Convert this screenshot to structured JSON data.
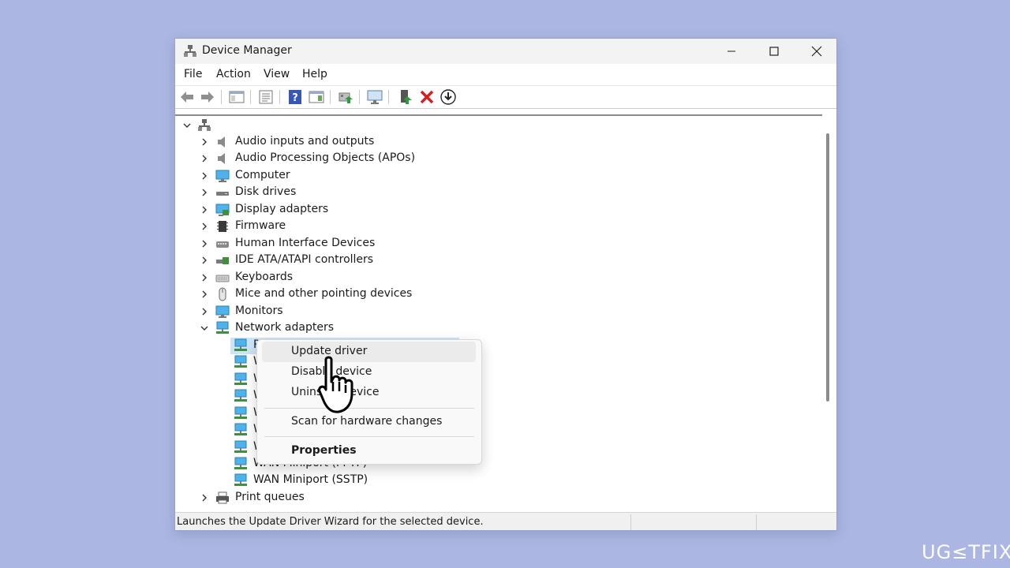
{
  "window": {
    "title": "Device Manager",
    "controls": [
      "minimize-icon",
      "maximize-icon",
      "close-icon"
    ]
  },
  "menu": [
    "File",
    "Action",
    "View",
    "Help"
  ],
  "toolbar": {
    "buttons": [
      "back-arrow-icon",
      "forward-arrow-icon",
      "show-hide-console-tree-icon",
      "properties-icon",
      "help-icon",
      "action-pane-icon",
      "update-driver-icon",
      "scan-hardware-icon",
      "enable-device-icon",
      "uninstall-device-icon",
      "download-icon"
    ]
  },
  "tree": {
    "root_label": "",
    "categories": [
      {
        "label": "Audio inputs and outputs",
        "icon": "speaker-icon"
      },
      {
        "label": "Audio Processing Objects (APOs)",
        "icon": "speaker-icon"
      },
      {
        "label": "Computer",
        "icon": "monitor-icon"
      },
      {
        "label": "Disk drives",
        "icon": "disk-drive-icon"
      },
      {
        "label": "Display adapters",
        "icon": "display-adapter-icon"
      },
      {
        "label": "Firmware",
        "icon": "firmware-chip-icon"
      },
      {
        "label": "Human Interface Devices",
        "icon": "hid-icon"
      },
      {
        "label": "IDE ATA/ATAPI controllers",
        "icon": "ide-controller-icon"
      },
      {
        "label": "Keyboards",
        "icon": "keyboard-icon"
      },
      {
        "label": "Mice and other pointing devices",
        "icon": "mouse-icon"
      },
      {
        "label": "Monitors",
        "icon": "monitor-icon"
      },
      {
        "label": "Network adapters",
        "icon": "network-adapter-icon",
        "expanded": true
      }
    ],
    "network_children": [
      {
        "label": "R",
        "selected": true
      },
      {
        "label": "W"
      },
      {
        "label": "W"
      },
      {
        "label": "W"
      },
      {
        "label": "W"
      },
      {
        "label": "W"
      },
      {
        "label": "W"
      },
      {
        "label": "WAN Miniport (PPTP)"
      },
      {
        "label": "WAN Miniport (SSTP)"
      }
    ],
    "after": [
      {
        "label": "Print queues",
        "icon": "printer-icon"
      }
    ]
  },
  "context_menu": {
    "items": [
      {
        "label": "Update driver",
        "highlighted": true
      },
      {
        "label": "Disable device"
      },
      {
        "label": "Uninstall device"
      },
      {
        "label": "Scan for hardware changes"
      },
      {
        "label": "Properties",
        "bold": true
      }
    ]
  },
  "statusbar": {
    "text": "Launches the Update Driver Wizard for the selected device."
  },
  "watermark": "UG≤TFIX"
}
